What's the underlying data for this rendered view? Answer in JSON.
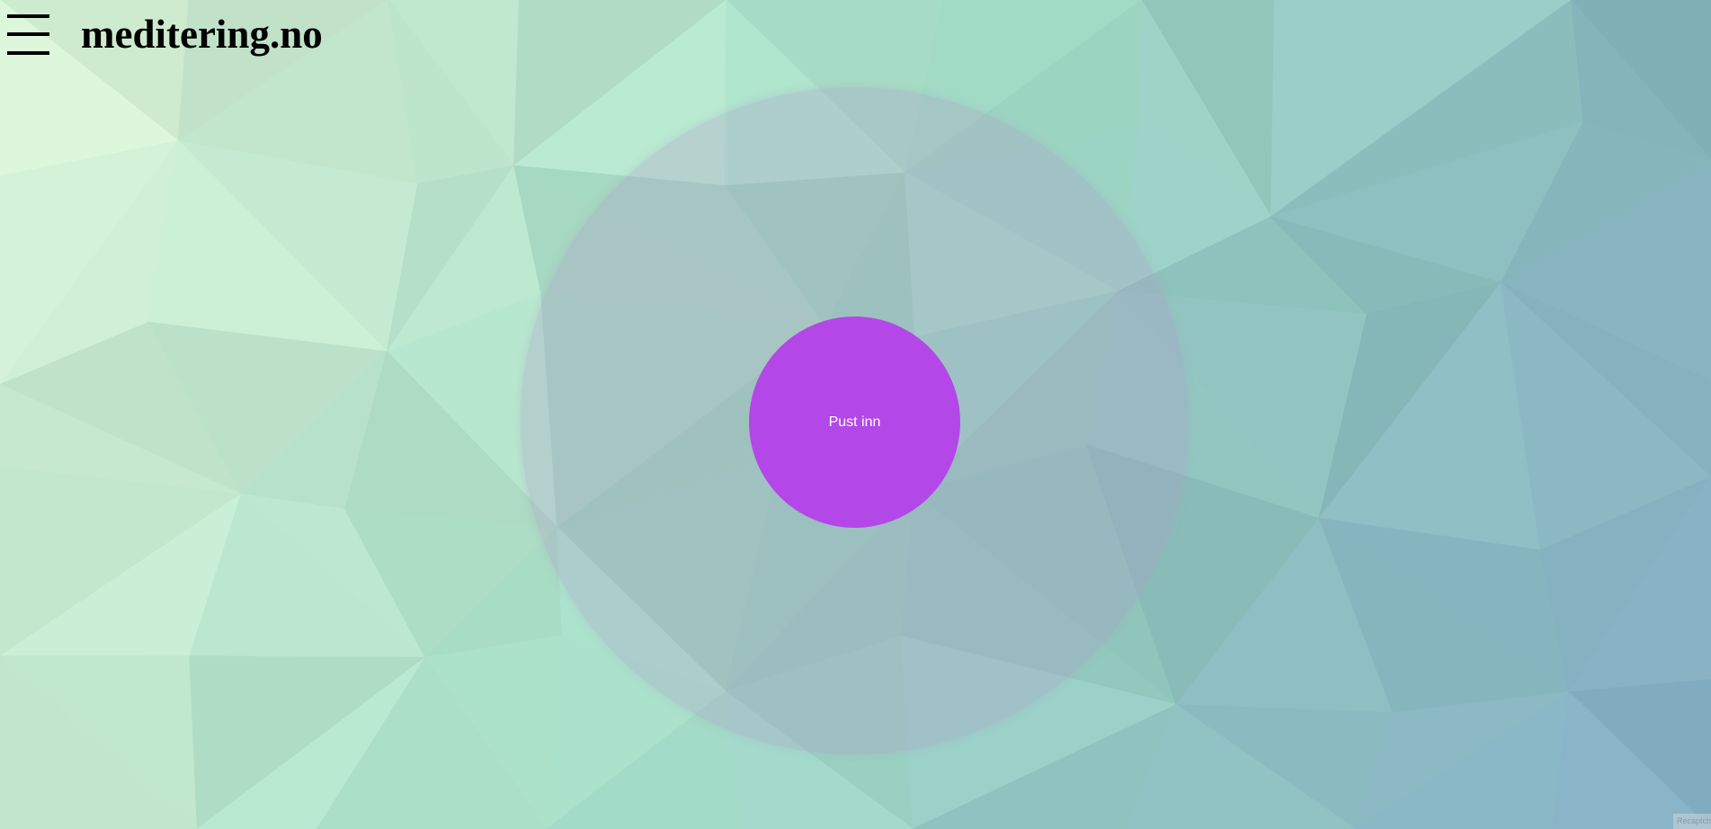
{
  "header": {
    "menu_icon": "hamburger-menu-icon",
    "site_title": "meditering.no"
  },
  "main": {
    "breath_button_label": "Pust inn"
  },
  "badge": {
    "label": "Recaptcha"
  },
  "colors": {
    "accent": "#b447e8",
    "button_text": "#ffffff",
    "title_text": "#000000",
    "background_light": "#d8f0d4",
    "background_mid": "#9dd6c4",
    "background_dark": "#7aa8bc"
  }
}
